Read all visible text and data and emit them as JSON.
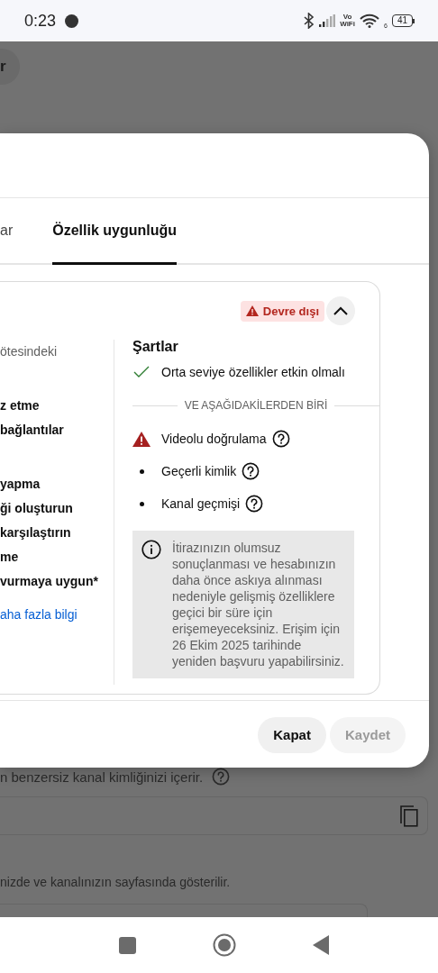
{
  "status_bar": {
    "time": "0:23",
    "vo": "Vo",
    "wifi_label": "WiFi",
    "wifi_band": "6",
    "battery": "41"
  },
  "background": {
    "chip": "r",
    "caption": "n benzersiz kanal kimliğinizi içerir.",
    "note": "nizde ve kanalınızın sayfasında gösterilir."
  },
  "dialog": {
    "tabs": [
      {
        "label": "ar",
        "selected": false
      },
      {
        "label": "Özellik uygunluğu",
        "selected": true
      }
    ],
    "card": {
      "status": "Devre dışı",
      "expanded": true,
      "left_lines": [
        {
          "kind": "muted",
          "text": "ötesindeki"
        },
        {
          "kind": "gap"
        },
        {
          "kind": "bold",
          "text": "z etme"
        },
        {
          "kind": "bold",
          "text": "bağlantılar"
        },
        {
          "kind": "gap"
        },
        {
          "kind": "bold",
          "text": "yapma"
        },
        {
          "kind": "bold",
          "text": "ği oluşturun"
        },
        {
          "kind": "bold",
          "text": "karşılaştırın"
        },
        {
          "kind": "bold",
          "text": "me"
        },
        {
          "kind": "bold",
          "text": "vurmaya uygun*"
        },
        {
          "kind": "link",
          "text": "aha fazla bilgi"
        }
      ],
      "title": "Şartlar",
      "requirements": [
        {
          "kind": "met",
          "text": "Orta seviye özellikler etkin olmalı"
        }
      ],
      "divider_label": "VE AŞAĞIDAKİLERDEN BİRİ",
      "alternatives": [
        {
          "kind": "warning",
          "text": "Videolu doğrulama"
        },
        {
          "kind": "bullet",
          "text": "Geçerli kimlik"
        },
        {
          "kind": "bullet",
          "text": "Kanal geçmişi"
        }
      ],
      "notice": "İtirazınızın olumsuz sonuçlanması ve hesabınızın daha önce askıya alınması nedeniyle gelişmiş özelliklere geçici bir süre için erişemeyeceksiniz. Erişim için 26 Ekim 2025 tarihinde yeniden başvuru yapabilirsiniz."
    },
    "buttons": [
      {
        "label": "Kapat",
        "disabled": false
      },
      {
        "label": "Kaydet",
        "disabled": true
      }
    ]
  }
}
